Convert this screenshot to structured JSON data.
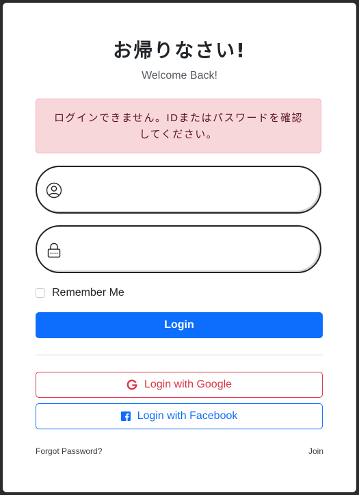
{
  "header": {
    "title": "お帰りなさい!",
    "subtitle": "Welcome Back!"
  },
  "alert": {
    "message": "ログインできません。IDまたはパスワードを確認してください。"
  },
  "form": {
    "username": {
      "value": "",
      "placeholder": "",
      "icon": "user-circle-icon"
    },
    "password": {
      "value": "",
      "placeholder": "",
      "icon": "lock-icon"
    },
    "remember_label": "Remember Me",
    "remember_checked": false,
    "login_label": "Login"
  },
  "social": {
    "google_label": "Login with Google",
    "google_icon": "google-icon",
    "facebook_label": "Login with Facebook",
    "facebook_icon": "facebook-icon"
  },
  "footer": {
    "forgot_label": "Forgot Password?",
    "join_label": "Join"
  },
  "colors": {
    "primary": "#0d6efd",
    "danger": "#dc3545",
    "alert_bg": "#f8d7da",
    "alert_text": "#58151c"
  }
}
